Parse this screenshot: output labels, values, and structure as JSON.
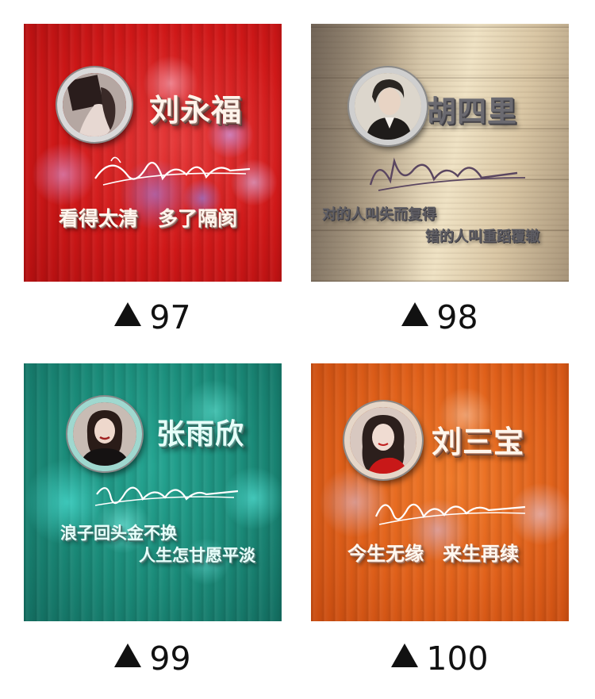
{
  "cards": [
    {
      "name": "刘永福",
      "slogan_lines": [
        "看得太清　多了隔阂"
      ],
      "score": "97",
      "theme_color": "#d01818",
      "avatar_icon": "portrait-woman-hiding-face-icon",
      "signature_icon": "handwritten-signature-icon"
    },
    {
      "name": "胡四里",
      "slogan_lines": [
        "对的人叫失而复得",
        "错的人叫重蹈覆辙"
      ],
      "score": "98",
      "theme_color": "#d9c6a4",
      "avatar_icon": "portrait-young-man-icon",
      "signature_icon": "handwritten-signature-icon"
    },
    {
      "name": "张雨欣",
      "slogan_lines": [
        "浪子回头金不换",
        "人生怎甘愿平淡"
      ],
      "score": "99",
      "theme_color": "#1a8a78",
      "avatar_icon": "portrait-woman-in-black-icon",
      "signature_icon": "handwritten-signature-icon"
    },
    {
      "name": "刘三宝",
      "slogan_lines": [
        "今生无缘　来生再续"
      ],
      "score": "100",
      "theme_color": "#e0601a",
      "avatar_icon": "portrait-woman-in-red-icon",
      "signature_icon": "handwritten-signature-icon"
    }
  ],
  "score_icon": "up-triangle-icon"
}
